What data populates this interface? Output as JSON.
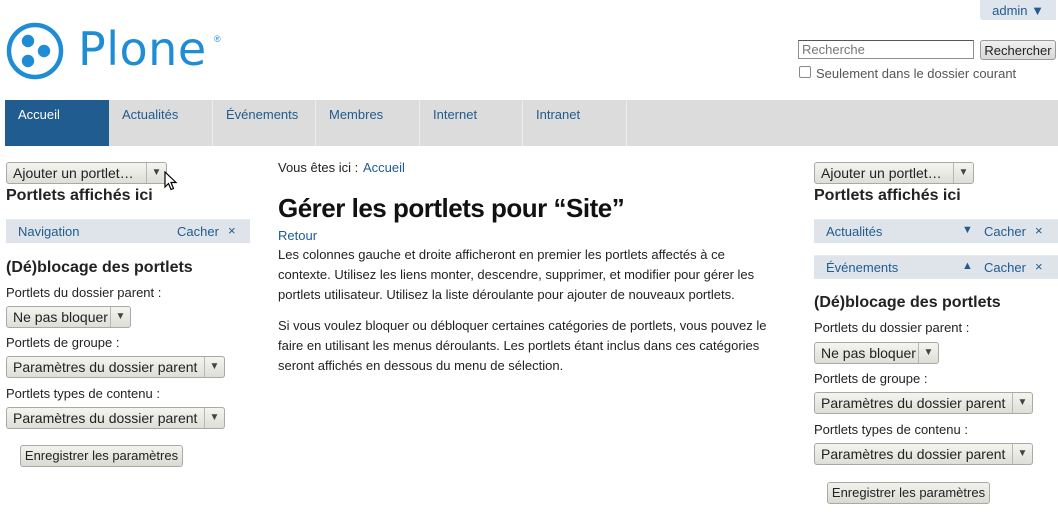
{
  "user_menu": {
    "label": "admin ▼"
  },
  "logo": {
    "text": "Plone",
    "reg": "®"
  },
  "search": {
    "placeholder": "Recherche",
    "button_label": "Rechercher",
    "checkbox_label": "Seulement dans le dossier courant",
    "checkbox_checked": false
  },
  "nav": {
    "tabs": [
      {
        "label": "Accueil",
        "active": true
      },
      {
        "label": "Actualités"
      },
      {
        "label": "Événements"
      },
      {
        "label": "Membres"
      },
      {
        "label": "Internet"
      },
      {
        "label": "Intranet"
      }
    ]
  },
  "left": {
    "add_portlet": "Ajouter un portlet…",
    "heading": "Portlets affichés ici",
    "portlets": [
      {
        "name": "Navigation",
        "hide": "Cacher",
        "remove": "×"
      }
    ],
    "blocking_heading": "(Dé)blocage des portlets",
    "parent_label": "Portlets du dossier parent :",
    "parent_value": "Ne pas bloquer",
    "group_label": "Portlets de groupe :",
    "group_value": "Paramètres du dossier parent",
    "type_label": "Portlets types de contenu :",
    "type_value": "Paramètres du dossier parent",
    "save_label": "Enregistrer les paramètres"
  },
  "center": {
    "breadcrumb_label": "Vous êtes ici :",
    "breadcrumb_link": "Accueil",
    "title": "Gérer les portlets pour “Site”",
    "back": "Retour",
    "para1": "Les colonnes gauche et droite afficheront en premier les portlets affectés à ce contexte. Utilisez les liens monter, descendre, supprimer, et modifier pour gérer les portlets utilisateur. Utilisez la liste déroulante pour ajouter de nouveaux portlets.",
    "para2": "Si vous voulez bloquer ou débloquer certaines catégories de portlets, vous pouvez le faire en utilisant les menus déroulants. Les portlets étant inclus dans ces catégories seront affichés en dessous du menu de sélection."
  },
  "right": {
    "add_portlet": "Ajouter un portlet…",
    "heading": "Portlets affichés ici",
    "portlets": [
      {
        "name": "Actualités",
        "move": "▼",
        "hide": "Cacher",
        "remove": "×"
      },
      {
        "name": "Événements",
        "move": "▲",
        "hide": "Cacher",
        "remove": "×"
      }
    ],
    "blocking_heading": "(Dé)blocage des portlets",
    "parent_label": "Portlets du dossier parent :",
    "parent_value": "Ne pas bloquer",
    "group_label": "Portlets de groupe :",
    "group_value": "Paramètres du dossier parent",
    "type_label": "Portlets types de contenu :",
    "type_value": "Paramètres du dossier parent",
    "save_label": "Enregistrer les paramètres"
  },
  "colors": {
    "brand": "#1f8dd6",
    "nav_active": "#205c90",
    "link": "#205c90"
  }
}
